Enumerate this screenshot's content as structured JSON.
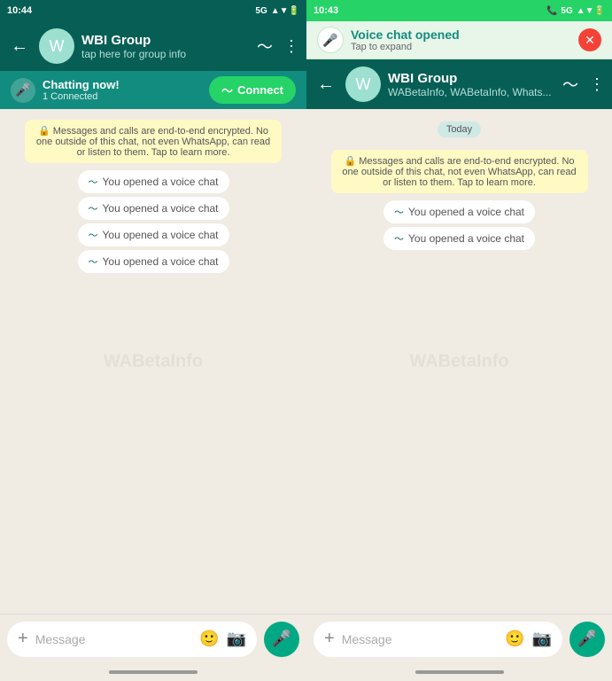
{
  "left": {
    "status_bar": {
      "time": "10:44",
      "icons": "5G▲▼🔋"
    },
    "header": {
      "group_name": "WBI Group",
      "subtitle": "tap here for group info",
      "back_icon": "←",
      "menu_icon": "⋮",
      "waveform_icon": "〜"
    },
    "voice_banner": {
      "title": "Chatting now!",
      "connected_count": "1 Connected",
      "connect_label": "Connect",
      "mic_icon": "🎤"
    },
    "encryption_notice": "🔒 Messages and calls are end-to-end encrypted. No one outside of this chat, not even WhatsApp, can read or listen to them. Tap to learn more.",
    "system_messages": [
      "You opened a voice chat",
      "You opened a voice chat",
      "You opened a voice chat",
      "You opened a voice chat"
    ],
    "bottom_bar": {
      "add_icon": "+",
      "placeholder": "Message",
      "emoji_icon": "🙂",
      "camera_icon": "📷",
      "mic_icon": "🎤"
    }
  },
  "right": {
    "status_bar": {
      "time": "10:43",
      "call_icon": "📞",
      "icons": "5G▲▼🔋"
    },
    "voice_popup": {
      "title": "Voice chat opened",
      "subtitle": "Tap to expand",
      "mic_icon": "🎤",
      "close_icon": "✕"
    },
    "header": {
      "group_name": "WBI Group",
      "subtitle": "WABetaInfo, WABetaInfo, Whats...",
      "back_icon": "←",
      "menu_icon": "⋮",
      "waveform_icon": "〜"
    },
    "today_label": "Today",
    "encryption_notice": "🔒 Messages and calls are end-to-end encrypted. No one outside of this chat, not even WhatsApp, can read or listen to them. Tap to learn more.",
    "system_messages": [
      "You opened a voice chat",
      "You opened a voice chat"
    ],
    "bottom_bar": {
      "add_icon": "+",
      "placeholder": "Message",
      "emoji_icon": "🙂",
      "camera_icon": "📷",
      "mic_icon": "🎤"
    }
  },
  "watermark": "WABetaInfo",
  "colors": {
    "header_bg": "#075e54",
    "accent_green": "#25d366",
    "chat_bg": "#f0ebe3",
    "voice_banner": "#128c7e"
  }
}
